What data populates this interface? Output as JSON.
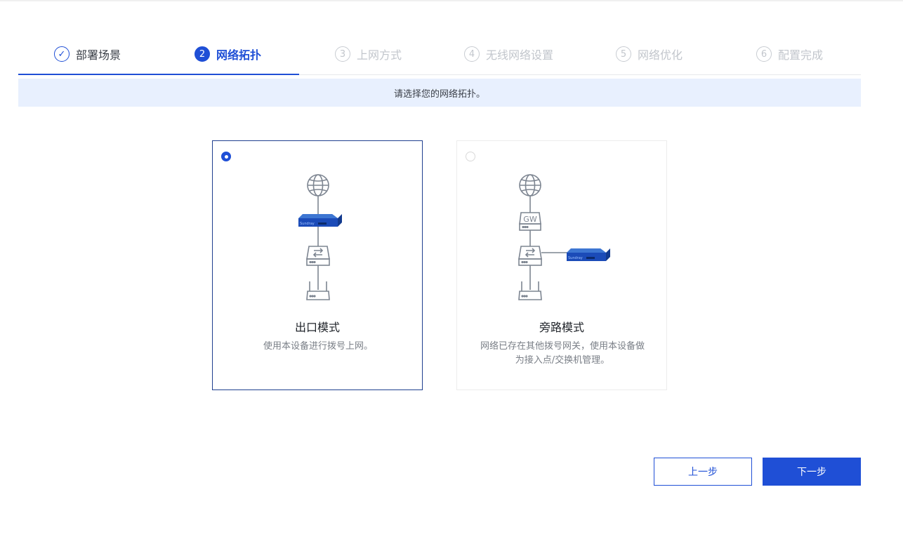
{
  "steps": [
    {
      "num": "✓",
      "label": "部署场景",
      "state": "done"
    },
    {
      "num": "2",
      "label": "网络拓扑",
      "state": "active"
    },
    {
      "num": "3",
      "label": "上网方式",
      "state": "pending"
    },
    {
      "num": "4",
      "label": "无线网络设置",
      "state": "pending"
    },
    {
      "num": "5",
      "label": "网络优化",
      "state": "pending"
    },
    {
      "num": "6",
      "label": "配置完成",
      "state": "pending"
    }
  ],
  "hint": "请选择您的网络拓扑。",
  "options": [
    {
      "title": "出口模式",
      "desc": "使用本设备进行拨号上网。",
      "selected": true,
      "device_brand": "Sundray"
    },
    {
      "title": "旁路模式",
      "desc": "网络已存在其他拨号网关，使用本设备做为接入点/交换机管理。",
      "selected": false,
      "gateway_label": "GW",
      "device_brand": "Sundray"
    }
  ],
  "buttons": {
    "prev": "上一步",
    "next": "下一步"
  },
  "colors": {
    "accent": "#1f4fd6",
    "hint_bg": "#e8f0fe",
    "icon_gray": "#7d8591"
  }
}
